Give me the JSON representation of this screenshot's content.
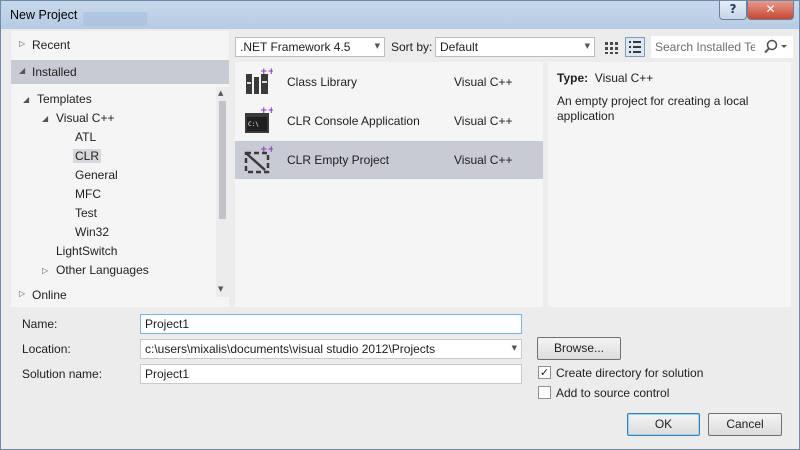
{
  "window": {
    "title": "New Project",
    "help_label": "?",
    "close_label": "✕"
  },
  "nav": {
    "recent": "Recent",
    "installed": "Installed",
    "online": "Online",
    "tree": [
      {
        "label": "Templates",
        "expanded": true
      },
      {
        "label": "Visual C++",
        "expanded": true
      },
      {
        "label": "ATL"
      },
      {
        "label": "CLR",
        "selected": true
      },
      {
        "label": "General"
      },
      {
        "label": "MFC"
      },
      {
        "label": "Test"
      },
      {
        "label": "Win32"
      },
      {
        "label": "LightSwitch"
      },
      {
        "label": "Other Languages",
        "expanded": false
      }
    ]
  },
  "toolbar": {
    "framework": ".NET Framework 4.5",
    "sort_by_label": "Sort by:",
    "sort_by_value": "Default",
    "search_placeholder": "Search Installed Te"
  },
  "templates": [
    {
      "name": "Class Library",
      "language": "Visual C++"
    },
    {
      "name": "CLR Console Application",
      "language": "Visual C++"
    },
    {
      "name": "CLR Empty Project",
      "language": "Visual C++",
      "selected": true
    }
  ],
  "description": {
    "type_label": "Type:",
    "type_value": "Visual C++",
    "text": "An empty project for creating a local application"
  },
  "form": {
    "name_label": "Name:",
    "name_value": "Project1",
    "location_label": "Location:",
    "location_value": "c:\\users\\mixalis\\documents\\visual studio 2012\\Projects",
    "solution_label": "Solution name:",
    "solution_value": "Project1",
    "browse_label": "Browse...",
    "create_dir_label": "Create directory for solution",
    "create_dir_checked": true,
    "source_control_label": "Add to source control",
    "source_control_checked": false,
    "ok_label": "OK",
    "cancel_label": "Cancel"
  },
  "colors": {
    "accent": "#c8cad4",
    "icon_plus": "#8a3fbf",
    "focus_border": "#7fb4e0"
  }
}
